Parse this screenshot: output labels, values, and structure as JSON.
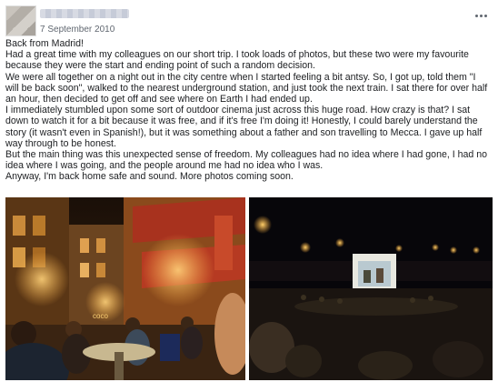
{
  "post": {
    "date": "7 September 2010",
    "paragraphs": [
      "Back from Madrid!",
      "Had a great time with my colleagues on our short trip. I took loads of photos, but these two were my favourite because they were the start and ending point of such a random decision.",
      "We were all together on a night out in the city centre when I started feeling a bit antsy. So, I got up, told them \"I will be back soon\", walked to the nearest underground station, and just took the next train. I sat there for over half an hour, then decided to get off and see where on Earth I had ended up.",
      "I immediately stumbled upon some sort of outdoor cinema just across this huge road. How crazy is that? I sat down to watch it for a bit because it was free, and if it's free I'm doing it! Honestly, I could barely understand the story (it wasn't even in Spanish!), but it was something about a father and son travelling to Mecca. I gave up half way through to be honest.",
      "But the main thing was this unexpected sense of freedom. My colleagues had no idea where I had gone, I had no idea where I was going, and the people around me had no idea who I was.",
      "Anyway, I'm back home safe and sound. More photos coming soon."
    ],
    "photos": [
      {
        "icon": "street-terrace-night-photo"
      },
      {
        "icon": "outdoor-cinema-night-photo"
      }
    ]
  },
  "colors": {
    "text": "#1c1e21",
    "meta": "#606770",
    "background": "#ffffff"
  }
}
